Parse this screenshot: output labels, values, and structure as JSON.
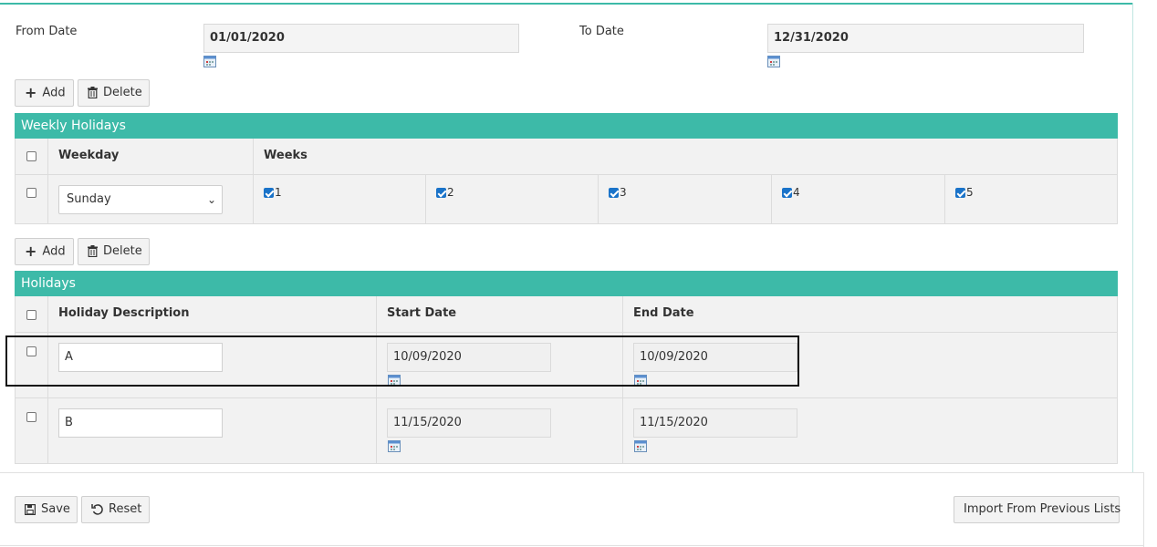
{
  "date_range": {
    "from_label": "From Date",
    "from_value": "01/01/2020",
    "to_label": "To Date",
    "to_value": "12/31/2020"
  },
  "toolbar1": {
    "add_label": "Add",
    "delete_label": "Delete"
  },
  "weekly_holidays": {
    "title": "Weekly Holidays",
    "headers": {
      "weekday": "Weekday",
      "weeks": "Weeks"
    },
    "row": {
      "weekday": "Sunday",
      "weeks": [
        {
          "label": "1",
          "checked": true
        },
        {
          "label": "2",
          "checked": true
        },
        {
          "label": "3",
          "checked": true
        },
        {
          "label": "4",
          "checked": true
        },
        {
          "label": "5",
          "checked": true
        }
      ]
    }
  },
  "toolbar2": {
    "add_label": "Add",
    "delete_label": "Delete"
  },
  "holidays": {
    "title": "Holidays",
    "headers": {
      "description": "Holiday Description",
      "start": "Start Date",
      "end": "End Date"
    },
    "rows": [
      {
        "description": "A",
        "start": "10/09/2020",
        "end": "10/09/2020"
      },
      {
        "description": "B",
        "start": "11/15/2020",
        "end": "11/15/2020"
      }
    ]
  },
  "footer": {
    "save_label": "Save",
    "reset_label": "Reset",
    "import_label": "Import From Previous Lists"
  },
  "colors": {
    "accent": "#3dbaa8",
    "checkbox": "#1a73c9"
  },
  "icons": [
    "calendar-icon",
    "plus-icon",
    "trash-icon",
    "save-icon",
    "undo-icon",
    "chevron-down-icon"
  ]
}
